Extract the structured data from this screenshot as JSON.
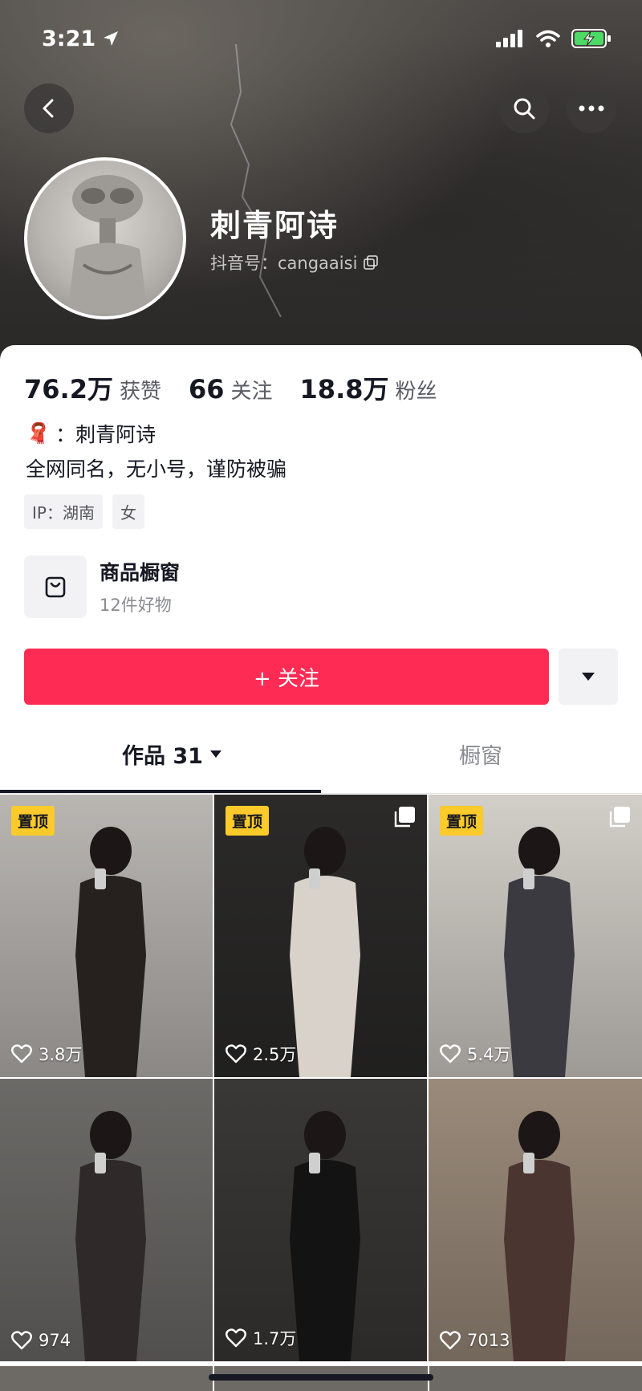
{
  "status_bar": {
    "time": "3:21"
  },
  "profile": {
    "name": "刺青阿诗",
    "id_label": "抖音号：cangaaisi"
  },
  "stats": [
    {
      "num": "76.2万",
      "label": "获赞"
    },
    {
      "num": "66",
      "label": "关注"
    },
    {
      "num": "18.8万",
      "label": "粉丝"
    }
  ],
  "bio": {
    "line1_badge": "🧣",
    "line1_text": "：刺青阿诗",
    "line2": "全网同名，无小号，谨防被骗"
  },
  "tags": [
    "IP：湖南",
    "女"
  ],
  "shop": {
    "title": "商品橱窗",
    "subtitle": "12件好物"
  },
  "follow_button": "+ 关注",
  "tabs": {
    "works": "作品 31",
    "showcase": "橱窗"
  },
  "posts": [
    {
      "pinned": "置顶",
      "likes": "3.8万",
      "multi": false,
      "bg": "#b9b6b2"
    },
    {
      "pinned": "置顶",
      "likes": "2.5万",
      "multi": true,
      "bg": "#2b2a29"
    },
    {
      "pinned": "置顶",
      "likes": "5.4万",
      "multi": true,
      "bg": "#d2cec8"
    },
    {
      "pinned": "",
      "likes": "974",
      "multi": false,
      "bg": "#6c6a67"
    },
    {
      "pinned": "",
      "likes": "1.7万",
      "multi": false,
      "bg": "#3a3836"
    },
    {
      "pinned": "",
      "likes": "7013",
      "multi": false,
      "bg": "#9a8a7a"
    }
  ],
  "icons": {
    "back": "chevron-left-icon",
    "search": "search-icon",
    "more": "more-dots-icon",
    "copy": "copy-icon",
    "shop": "bag-icon",
    "dropdown": "caret-down-icon",
    "like": "heart-icon"
  },
  "colors": {
    "accent": "#fe2c55",
    "pin": "#fcca2a"
  }
}
